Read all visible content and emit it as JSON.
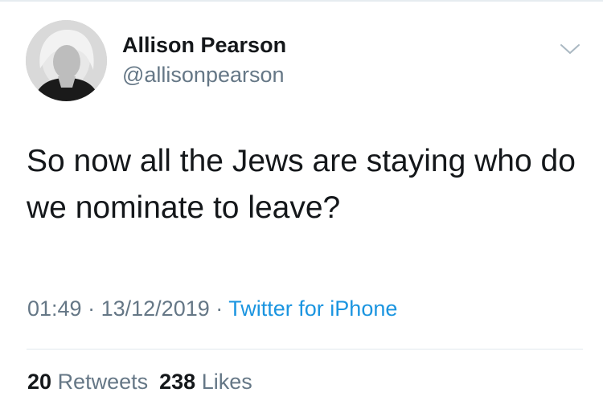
{
  "tweet": {
    "author": {
      "display_name": "Allison Pearson",
      "handle": "@allisonpearson"
    },
    "text": "So now all the Jews are staying who do we nominate to leave?",
    "time": "01:49",
    "date": "13/12/2019",
    "separator": "·",
    "source": "Twitter for iPhone",
    "stats": {
      "retweets_count": "20",
      "retweets_label": "Retweets",
      "likes_count": "238",
      "likes_label": "Likes"
    },
    "menu_icon": "chevron-down-icon"
  },
  "colors": {
    "text_primary": "#14171a",
    "text_secondary": "#657786",
    "link": "#1b95e0",
    "divider": "#e1e8ed"
  }
}
